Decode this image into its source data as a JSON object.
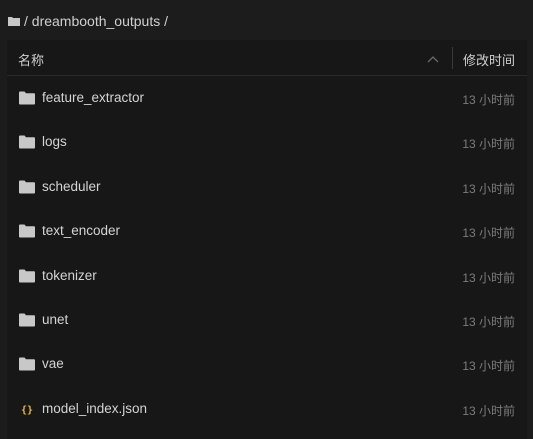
{
  "breadcrumb": {
    "path": "/ dreambooth_outputs /"
  },
  "table": {
    "col_name": "名称",
    "col_modified": "修改时间"
  },
  "files": [
    {
      "name": "feature_extractor",
      "type": "folder",
      "modified": "13 小时前"
    },
    {
      "name": "logs",
      "type": "folder",
      "modified": "13 小时前"
    },
    {
      "name": "scheduler",
      "type": "folder",
      "modified": "13 小时前"
    },
    {
      "name": "text_encoder",
      "type": "folder",
      "modified": "13 小时前"
    },
    {
      "name": "tokenizer",
      "type": "folder",
      "modified": "13 小时前"
    },
    {
      "name": "unet",
      "type": "folder",
      "modified": "13 小时前"
    },
    {
      "name": "vae",
      "type": "folder",
      "modified": "13 小时前"
    },
    {
      "name": "model_index.json",
      "type": "json",
      "modified": "13 小时前"
    }
  ],
  "colors": {
    "background": "#1c1c1c",
    "panel": "#171717",
    "folder": "#c8c8c8",
    "json": "#e8b84a"
  }
}
